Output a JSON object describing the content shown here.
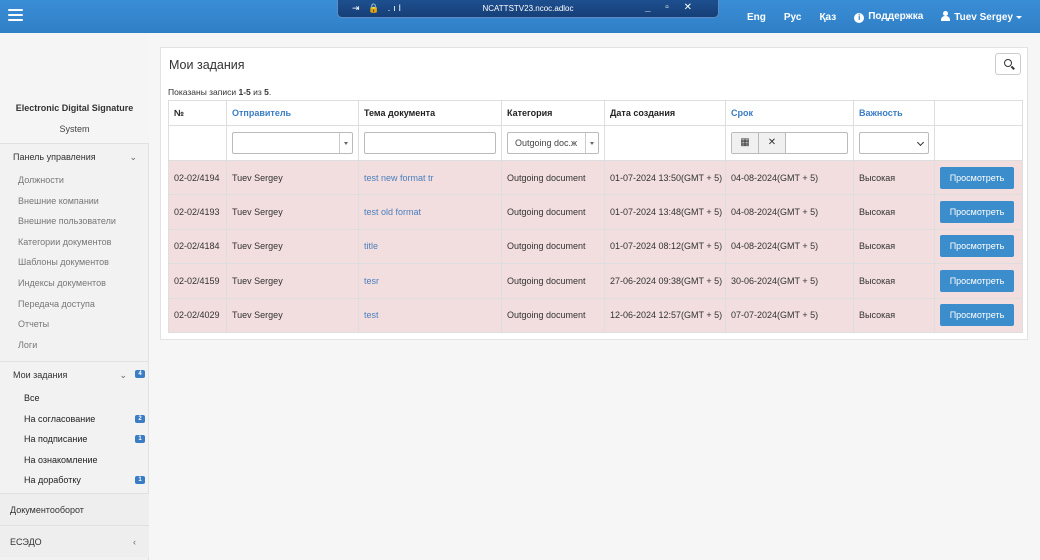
{
  "topbar": {
    "remote_title": "NCATTSTV23.ncoc.adloc",
    "remote_icons": "⇥ 🔒 .ıl",
    "remote_controls": "_ ▫ ✕",
    "languages": [
      "Eng",
      "Рус",
      "Қаз"
    ],
    "support_label": "Поддержка",
    "user_label": "Tuev Sergey"
  },
  "sidebar": {
    "brand_title": "Electronic Digital Signature",
    "brand_subtitle": "System",
    "control_panel": {
      "label": "Панель управления",
      "items": [
        "Должности",
        "Внешние компании",
        "Внешние пользователи",
        "Категории документов",
        "Шаблоны документов",
        "Индексы документов",
        "Передача доступа",
        "Отчеты",
        "Логи"
      ]
    },
    "my_tasks": {
      "label": "Мои задания",
      "badge": "4",
      "items": [
        {
          "label": "Все",
          "badge": ""
        },
        {
          "label": "На согласование",
          "badge": "2"
        },
        {
          "label": "На подписание",
          "badge": "1"
        },
        {
          "label": "На ознакомление",
          "badge": ""
        },
        {
          "label": "На доработку",
          "badge": "1"
        }
      ]
    },
    "doc_flow": "Документооборот",
    "esedo": "ЕСЭДО"
  },
  "main": {
    "title": "Мои задания",
    "records_prefix": "Показаны записи ",
    "records_range": "1-5",
    "records_mid": " из ",
    "records_total": "5",
    "records_suffix": ".",
    "columns": [
      "№",
      "Отправитель",
      "Тема документа",
      "Категория",
      "Дата создания",
      "Срок",
      "Важность",
      ""
    ],
    "filter_category_value": "Outgoing doc.ж",
    "view_button": "Просмотреть",
    "rows": [
      {
        "num": "02-02/4194",
        "sender": "Tuev Sergey",
        "subject": "test new format tr",
        "category": "Outgoing document",
        "created": "01-07-2024 13:50(GMT + 5)",
        "deadline": "04-08-2024(GMT + 5)",
        "importance": "Высокая"
      },
      {
        "num": "02-02/4193",
        "sender": "Tuev Sergey",
        "subject": "test old format",
        "category": "Outgoing document",
        "created": "01-07-2024 13:48(GMT + 5)",
        "deadline": "04-08-2024(GMT + 5)",
        "importance": "Высокая"
      },
      {
        "num": "02-02/4184",
        "sender": "Tuev Sergey",
        "subject": "title",
        "category": "Outgoing document",
        "created": "01-07-2024 08:12(GMT + 5)",
        "deadline": "04-08-2024(GMT + 5)",
        "importance": "Высокая"
      },
      {
        "num": "02-02/4159",
        "sender": "Tuev Sergey",
        "subject": "tesr",
        "category": "Outgoing document",
        "created": "27-06-2024 09:38(GMT + 5)",
        "deadline": "30-06-2024(GMT + 5)",
        "importance": "Высокая"
      },
      {
        "num": "02-02/4029",
        "sender": "Tuev Sergey",
        "subject": "test",
        "category": "Outgoing document",
        "created": "12-06-2024 12:57(GMT + 5)",
        "deadline": "07-07-2024(GMT + 5)",
        "importance": "Высокая"
      }
    ]
  },
  "colors": {
    "accent": "#3c8dcb",
    "topbar": "#2f7fc6",
    "row_highlight": "#f2dede"
  }
}
